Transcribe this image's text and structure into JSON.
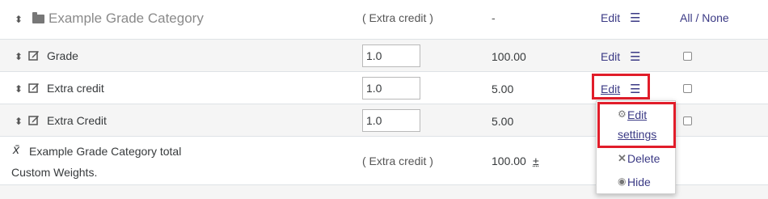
{
  "category": {
    "name": "Example Grade Category",
    "weight": "( Extra credit )",
    "max": "-",
    "edit": "Edit",
    "select": "All / None"
  },
  "items": [
    {
      "name": "Grade",
      "weight": "1.0",
      "max": "100.00",
      "edit": "Edit"
    },
    {
      "name": "Extra credit",
      "weight": "1.0",
      "max": "5.00",
      "edit": "Edit"
    },
    {
      "name": "Extra Credit",
      "weight": "1.0",
      "max": "5.00",
      "edit": "Edit"
    }
  ],
  "total": {
    "symbol": "x̄",
    "name": "Example Grade Category total",
    "subtitle": "Custom Weights.",
    "weight": "( Extra credit )",
    "max": "100.00",
    "max_suffix": "±"
  },
  "menu": {
    "edit_settings_line1": "Edit",
    "edit_settings_line2": "settings",
    "delete": "Delete",
    "hide": "Hide"
  },
  "icons": {
    "move": "move-icon",
    "folder": "folder-icon",
    "edit": "edit-icon",
    "hamburger": "hamburger-icon",
    "gear": "gear-icon",
    "delete": "delete-icon",
    "eye": "eye-icon"
  },
  "colors": {
    "link": "#3b3a85",
    "highlight": "#e11d2a",
    "row_alt": "#f5f5f5"
  }
}
